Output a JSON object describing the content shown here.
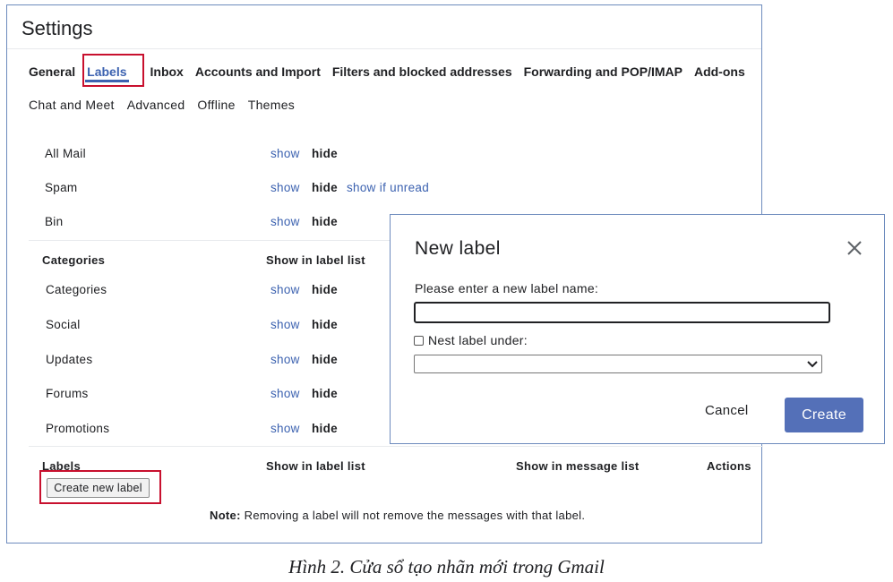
{
  "settings": {
    "title": "Settings",
    "tabs_primary": [
      "General",
      "Labels",
      "Inbox",
      "Accounts and Import",
      "Filters and blocked addresses",
      "Forwarding and POP/IMAP",
      "Add-ons"
    ],
    "active_tab": "Labels",
    "tabs_secondary": [
      "Chat and Meet",
      "Advanced",
      "Offline",
      "Themes"
    ],
    "system_labels": [
      {
        "name": "All Mail",
        "show": "show",
        "hide": "hide"
      },
      {
        "name": "Spam",
        "show": "show",
        "hide": "hide",
        "extra": "show if unread"
      },
      {
        "name": "Bin",
        "show": "show",
        "hide": "hide"
      }
    ],
    "categories_header": {
      "col1": "Categories",
      "col2": "Show in label list"
    },
    "categories": [
      {
        "name": "Categories",
        "show": "show",
        "hide": "hide"
      },
      {
        "name": "Social",
        "show": "show",
        "hide": "hide"
      },
      {
        "name": "Updates",
        "show": "show",
        "hide": "hide"
      },
      {
        "name": "Forums",
        "show": "show",
        "hide": "hide"
      },
      {
        "name": "Promotions",
        "show": "show",
        "hide": "hide"
      }
    ],
    "labels_header": {
      "col1": "Labels",
      "col2": "Show in label list",
      "col3": "Show in message list",
      "col4": "Actions"
    },
    "create_new_label": "Create new label",
    "note_prefix": "Note:",
    "note_text": " Removing a label will not remove the messages with that label."
  },
  "dialog": {
    "title": "New label",
    "prompt": "Please enter a new label name:",
    "input_value": "",
    "nest_label": "Nest label under:",
    "nest_checked": false,
    "select_value": "",
    "cancel": "Cancel",
    "create": "Create",
    "icons": {
      "close": "close-icon",
      "dropdown": "chevron-down-icon"
    }
  },
  "caption": "Hình 2. Cửa sổ tạo nhãn mới trong Gmail",
  "colors": {
    "accent": "#3c62b0",
    "highlight": "#c8102e",
    "create_button": "#5470b8"
  }
}
